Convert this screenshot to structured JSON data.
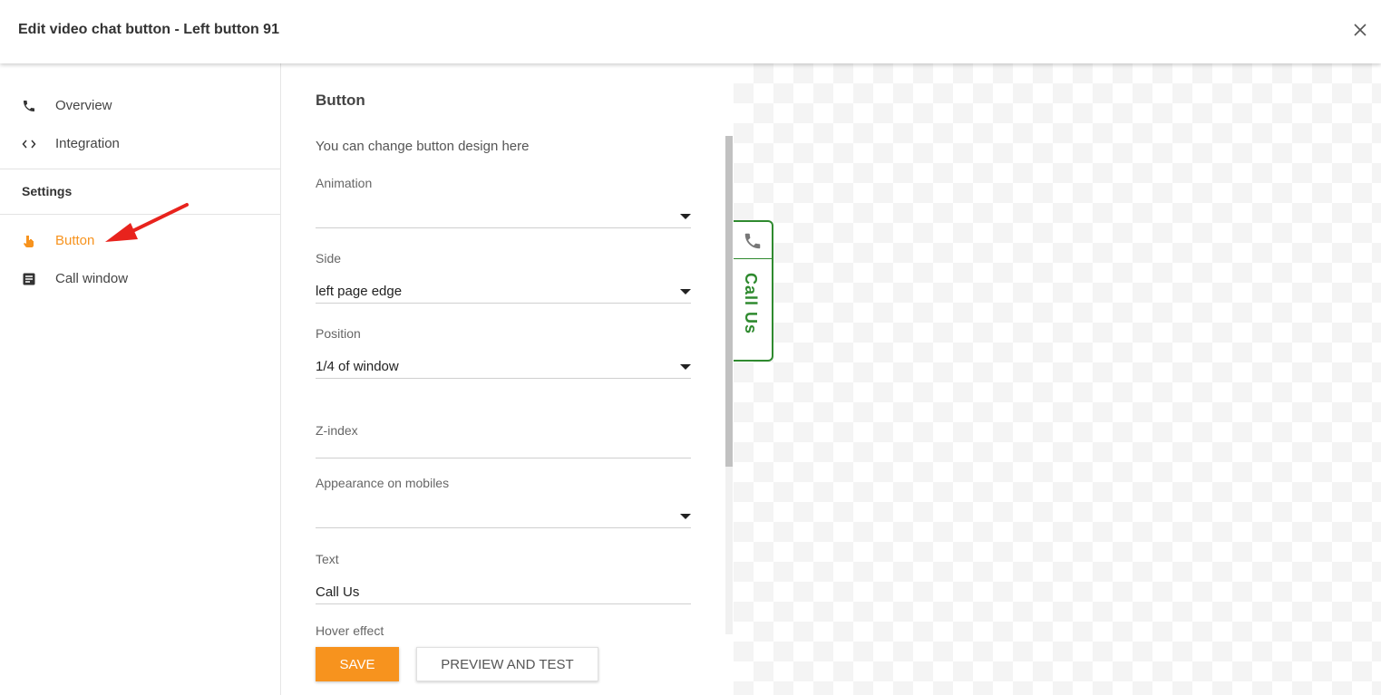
{
  "header": {
    "title": "Edit video chat button - Left button 91",
    "close_icon": "close-icon"
  },
  "sidebar": {
    "items": [
      {
        "label": "Overview",
        "icon": "phone-icon"
      },
      {
        "label": "Integration",
        "icon": "code-icon"
      }
    ],
    "section_title": "Settings",
    "settings_items": [
      {
        "label": "Button",
        "icon": "hand-pointer-icon",
        "active": true
      },
      {
        "label": "Call window",
        "icon": "document-icon"
      }
    ]
  },
  "form": {
    "heading": "Button",
    "description": "You can change button design here",
    "fields": [
      {
        "label": "Animation",
        "value": ""
      },
      {
        "label": "Side",
        "value": "left page edge"
      },
      {
        "label": "Position",
        "value": "1/4 of window"
      },
      {
        "label": "Z-index",
        "value": ""
      },
      {
        "label": "Appearance on mobiles",
        "value": ""
      },
      {
        "label": "Text",
        "value": "Call Us"
      },
      {
        "label": "Hover effect",
        "value": ""
      }
    ],
    "save_label": "SAVE",
    "preview_label": "PREVIEW AND TEST"
  },
  "preview": {
    "button_text": "Call Us",
    "icon": "phone-icon"
  },
  "colors": {
    "accent": "#f7931e",
    "widget_green": "#2f8a2f",
    "annotation_red": "#e8231d"
  }
}
